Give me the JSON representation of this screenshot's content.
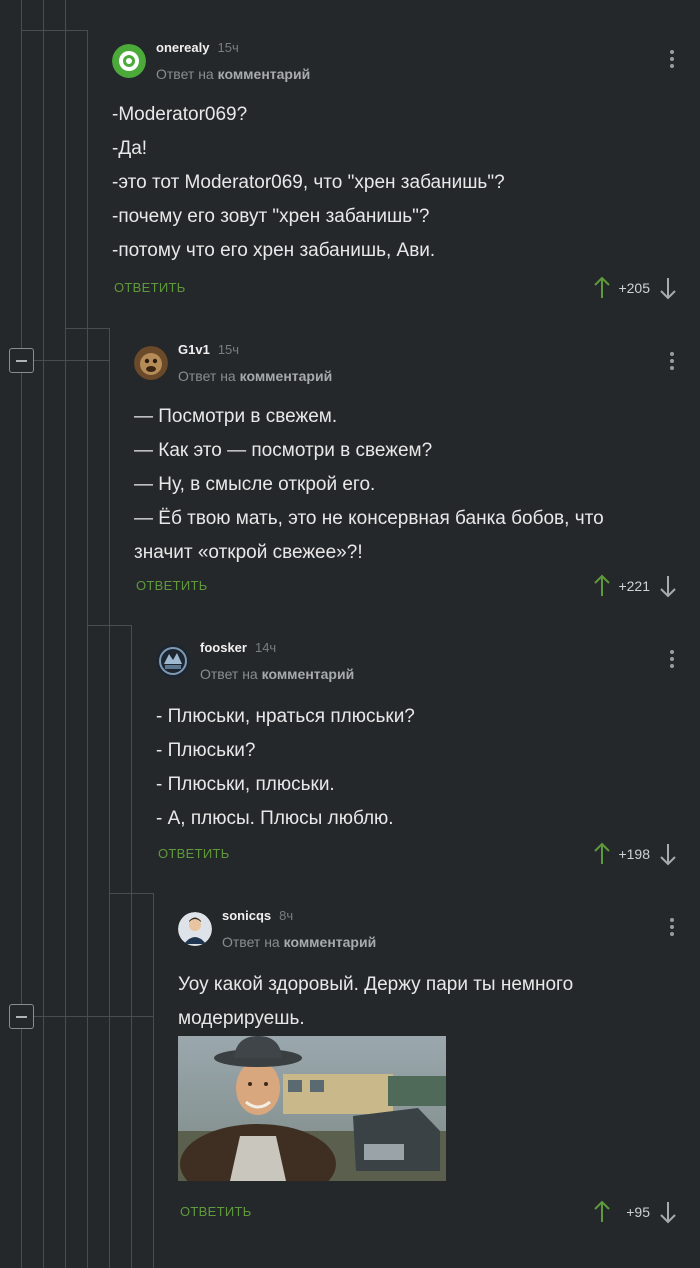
{
  "comments": [
    {
      "author": "onerealy",
      "time": "15ч",
      "reply_prefix": "Ответ на",
      "reply_target": "комментарий",
      "lines": [
        "-Moderator069?",
        "-Да!",
        "-это тот Moderator069, что \"хрен забанишь\"?",
        "-почему его зовут \"хрен забанишь\"?",
        "-потому что его хрен забанишь, Ави."
      ],
      "reply_label": "ОТВЕТИТЬ",
      "score": "+205",
      "avatar_icon": "green-ring-avatar"
    },
    {
      "author": "G1v1",
      "time": "15ч",
      "reply_prefix": "Ответ на",
      "reply_target": "комментарий",
      "lines": [
        "— Посмотри в свежем.",
        "— Как это — посмотри в свежем?",
        "— Ну, в смысле открой его.",
        "— Ёб твою мать, это не консервная банка бобов, что",
        "значит «открой свежее»?!"
      ],
      "reply_label": "ОТВЕТИТЬ",
      "score": "+221",
      "avatar_icon": "monkey-avatar"
    },
    {
      "author": "foosker",
      "time": "14ч",
      "reply_prefix": "Ответ на",
      "reply_target": "комментарий",
      "lines": [
        "- Плюськи, нраться плюськи?",
        "- Плюськи?",
        "- Плюськи, плюськи.",
        "- А, плюсы. Плюсы люблю."
      ],
      "reply_label": "ОТВЕТИТЬ",
      "score": "+198",
      "avatar_icon": "emblem-avatar"
    },
    {
      "author": "sonicqs",
      "time": "8ч",
      "reply_prefix": "Ответ на",
      "reply_target": "комментарий",
      "lines": [
        "Уоу какой здоровый. Держу пари ты немного",
        "модерируешь."
      ],
      "reply_label": "ОТВЕТИТЬ",
      "score": "+95",
      "avatar_icon": "person-avatar",
      "image": "man-in-hat-photo"
    }
  ],
  "colors": {
    "background": "#25282a",
    "reply_link": "#5e9a3c",
    "upvote_arrow": "#5e9a3c",
    "downvote_arrow": "#a8abad"
  }
}
